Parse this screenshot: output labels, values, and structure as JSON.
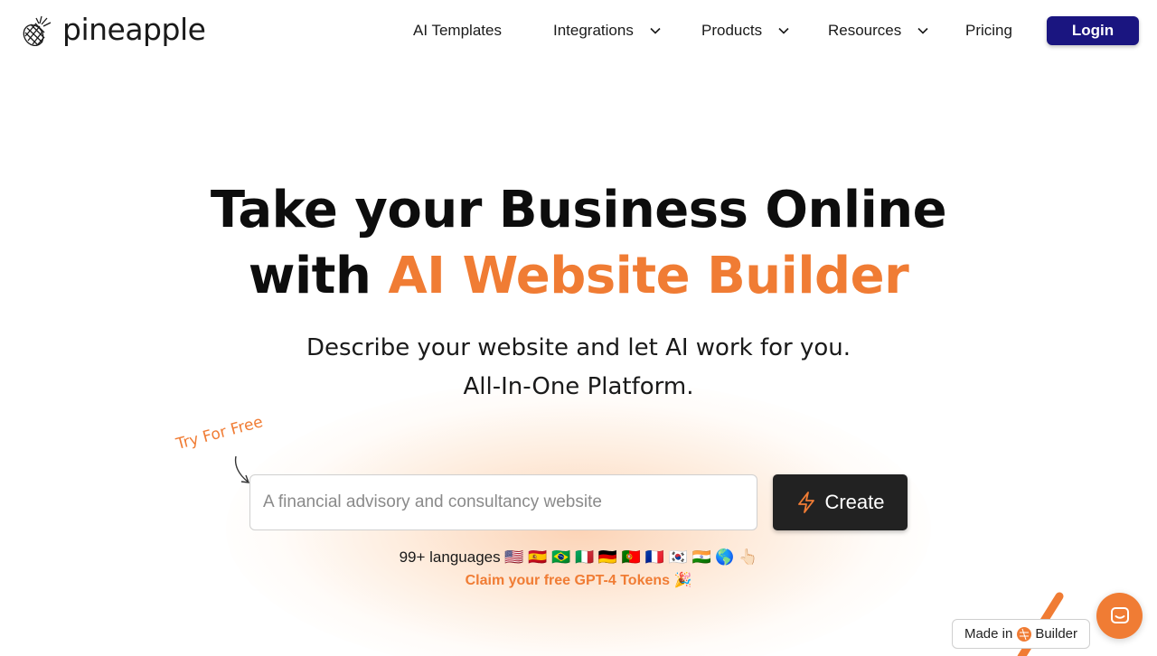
{
  "brand": {
    "name": "pineapple",
    "logo_icon": "pineapple-icon"
  },
  "nav": {
    "items": [
      {
        "label": "AI Templates",
        "has_dropdown": false
      },
      {
        "label": "Integrations",
        "has_dropdown": true
      },
      {
        "label": "Products",
        "has_dropdown": true
      },
      {
        "label": "Resources",
        "has_dropdown": true
      },
      {
        "label": "Pricing",
        "has_dropdown": false
      }
    ],
    "login_label": "Login"
  },
  "hero": {
    "title_line1": "Take your Business Online",
    "title_line2_prefix": "with ",
    "title_line2_accent": "AI Website Builder",
    "subtitle_line1": "Describe your website and let AI work for you.",
    "subtitle_line2": "All-In-One Platform."
  },
  "prompt": {
    "try_label": "Try For Free",
    "placeholder": "A financial advisory and consultancy website",
    "value": "",
    "create_label": "Create",
    "create_icon": "lightning-bolt-icon"
  },
  "languages_text": "99+ languages 🇺🇸 🇪🇸 🇧🇷 🇮🇹 🇩🇪 🇵🇹 🇫🇷 🇰🇷 🇮🇳 🌎 👆🏻",
  "claim_text": "Claim your free GPT-4 Tokens 🎉",
  "made_in": {
    "prefix": "Made in",
    "suffix": "Builder"
  },
  "colors": {
    "accent": "#f07c34",
    "login_bg": "#1a1580",
    "create_bg": "#222222"
  },
  "chat_icon": "chat-bubble-icon"
}
